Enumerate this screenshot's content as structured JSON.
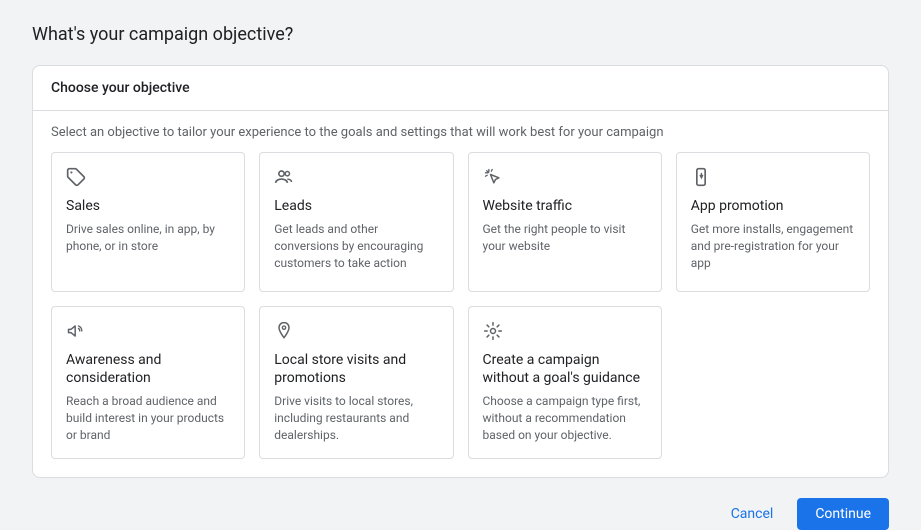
{
  "page_title": "What's your campaign objective?",
  "card": {
    "header": "Choose your objective",
    "subtext": "Select an objective to tailor your experience to the goals and settings that will work best for your campaign"
  },
  "objectives": [
    {
      "icon": "tag-icon",
      "title": "Sales",
      "desc": "Drive sales online, in app, by phone, or in store"
    },
    {
      "icon": "people-icon",
      "title": "Leads",
      "desc": "Get leads and other conversions by encouraging customers to take action"
    },
    {
      "icon": "click-icon",
      "title": "Website traffic",
      "desc": "Get the right people to visit your website"
    },
    {
      "icon": "phone-icon",
      "title": "App promotion",
      "desc": "Get more installs, engagement and pre-registration for your app"
    },
    {
      "icon": "megaphone-icon",
      "title": "Awareness and consideration",
      "desc": "Reach a broad audience and build interest in your products or brand"
    },
    {
      "icon": "pin-icon",
      "title": "Local store visits and promotions",
      "desc": "Drive visits to local stores, including restaurants and dealerships."
    },
    {
      "icon": "gear-icon",
      "title": "Create a campaign without a goal's guidance",
      "desc": "Choose a campaign type first, without a recommendation based on your objective."
    }
  ],
  "footer": {
    "cancel": "Cancel",
    "continue": "Continue"
  }
}
